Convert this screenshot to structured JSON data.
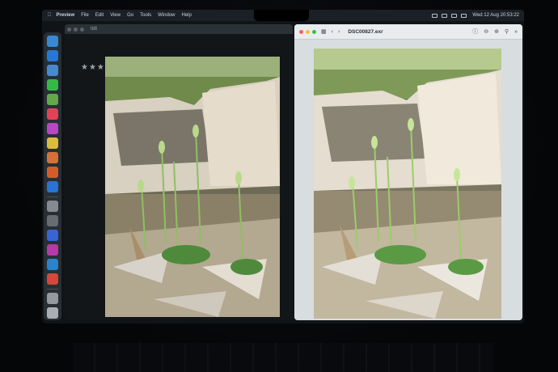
{
  "menubar": {
    "app_name": "Preview",
    "items": [
      "File",
      "Edit",
      "View",
      "Go",
      "Tools",
      "Window",
      "Help"
    ],
    "clock": "Wed 12 Aug  20:53:22"
  },
  "left_window": {
    "title": "tidt",
    "rating_stars": "★★★"
  },
  "right_window": {
    "file_title": "DSC00827.exr",
    "toolbar_icons": [
      "sidebar-icon",
      "back-icon",
      "forward-icon",
      "info-icon",
      "zoom-out-icon",
      "zoom-in-icon",
      "search-icon",
      "more-icon"
    ]
  },
  "colors": {
    "menubar": "#1a2025",
    "preview_window": "#d8dde0",
    "traffic_red": "#ff5f57",
    "traffic_yellow": "#febc2e",
    "traffic_green": "#28c840"
  }
}
